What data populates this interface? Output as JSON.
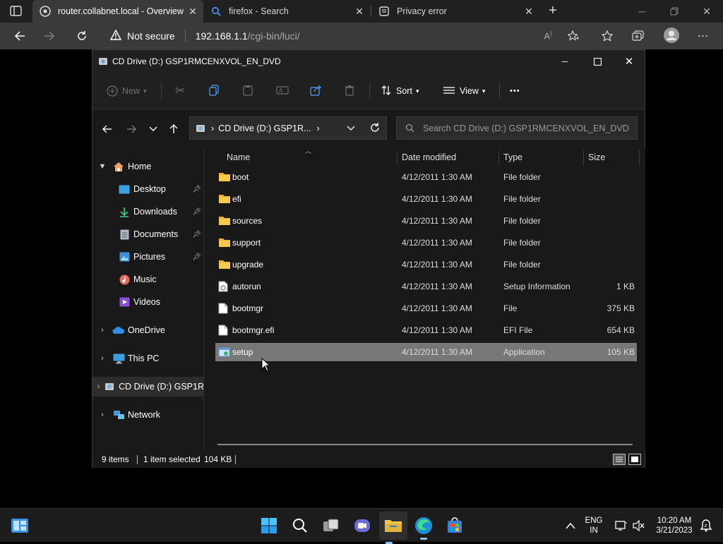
{
  "browser": {
    "tabs": [
      {
        "label": "router.collabnet.local - Overview",
        "active": true
      },
      {
        "label": "firefox - Search",
        "active": false
      },
      {
        "label": "Privacy error",
        "active": false
      }
    ],
    "address": {
      "security_label": "Not secure",
      "url_host": "192.168.1.1",
      "url_path": "/cgi-bin/luci/"
    }
  },
  "explorer": {
    "window_title": "CD Drive (D:) GSP1RMCENXVOL_EN_DVD",
    "commands": {
      "new_label": "New",
      "sort_label": "Sort",
      "view_label": "View",
      "more_label": "•••"
    },
    "path": {
      "crumb": "CD Drive (D:) GSP1R..."
    },
    "search": {
      "placeholder": "Search CD Drive (D:) GSP1RMCENXVOL_EN_DVD"
    },
    "nav": {
      "home": "Home",
      "quick": [
        "Desktop",
        "Downloads",
        "Documents",
        "Pictures",
        "Music",
        "Videos"
      ],
      "onedrive": "OneDrive",
      "thispc": "This PC",
      "cddrive": "CD Drive (D:) GSP1R",
      "network": "Network"
    },
    "columns": {
      "name": "Name",
      "date": "Date modified",
      "type": "Type",
      "size": "Size"
    },
    "files": [
      {
        "name": "boot",
        "date": "4/12/2011 1:30 AM",
        "type": "File folder",
        "size": "",
        "icon": "folder-icon"
      },
      {
        "name": "efi",
        "date": "4/12/2011 1:30 AM",
        "type": "File folder",
        "size": "",
        "icon": "folder-icon"
      },
      {
        "name": "sources",
        "date": "4/12/2011 1:30 AM",
        "type": "File folder",
        "size": "",
        "icon": "folder-icon"
      },
      {
        "name": "support",
        "date": "4/12/2011 1:30 AM",
        "type": "File folder",
        "size": "",
        "icon": "folder-icon"
      },
      {
        "name": "upgrade",
        "date": "4/12/2011 1:30 AM",
        "type": "File folder",
        "size": "",
        "icon": "folder-icon"
      },
      {
        "name": "autorun",
        "date": "4/12/2011 1:30 AM",
        "type": "Setup Information",
        "size": "1 KB",
        "icon": "setup-info-icon"
      },
      {
        "name": "bootmgr",
        "date": "4/12/2011 1:30 AM",
        "type": "File",
        "size": "375 KB",
        "icon": "file-icon"
      },
      {
        "name": "bootmgr.efi",
        "date": "4/12/2011 1:30 AM",
        "type": "EFI File",
        "size": "654 KB",
        "icon": "file-icon"
      },
      {
        "name": "setup",
        "date": "4/12/2011 1:30 AM",
        "type": "Application",
        "size": "105 KB",
        "icon": "application-icon",
        "selected": true
      }
    ],
    "status": {
      "items": "9 items",
      "selected": "1 item selected",
      "size": "104 KB"
    }
  },
  "taskbar": {
    "lang_line1": "ENG",
    "lang_line2": "IN",
    "time": "10:20 AM",
    "date": "3/21/2023"
  },
  "colors": {
    "accent": "#60cdff",
    "folder": "#f2c94c",
    "selected_row": "#777777"
  }
}
